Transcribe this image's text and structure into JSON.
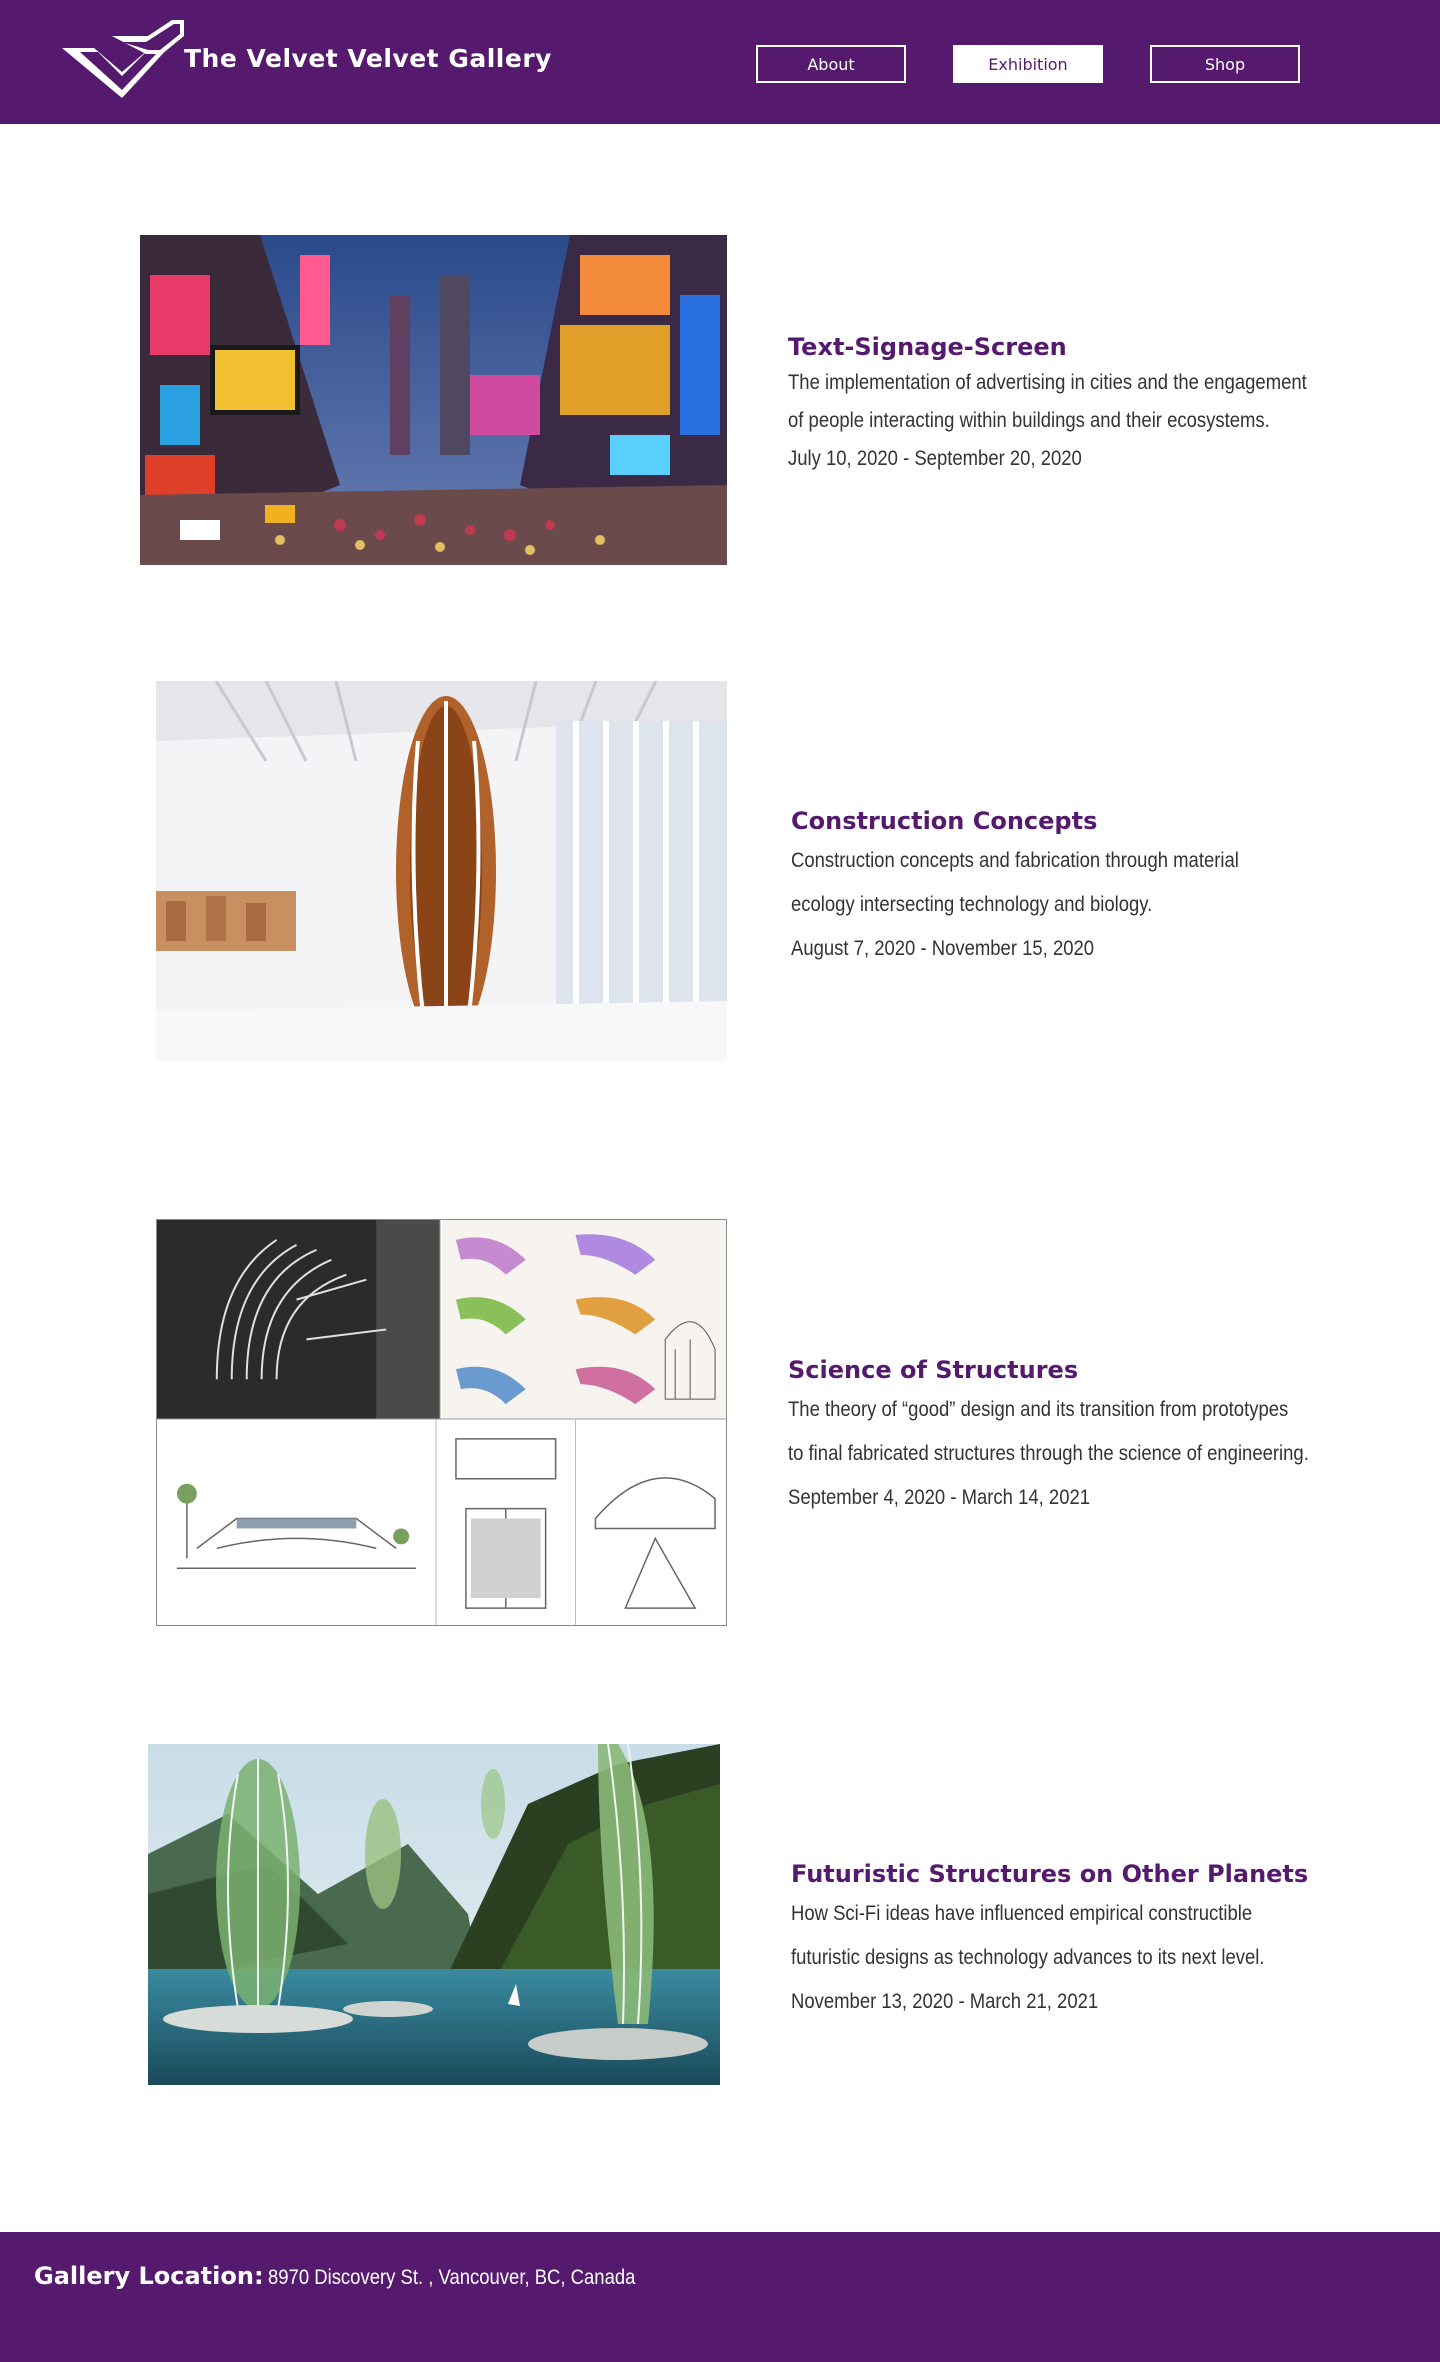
{
  "header": {
    "brand": "The Velvet Velvet Gallery",
    "logo_icon": "velvet-v-logo-icon",
    "nav": [
      {
        "label": "About",
        "active": false
      },
      {
        "label": "Exhibition",
        "active": true
      },
      {
        "label": "Shop",
        "active": false
      }
    ]
  },
  "exhibitions": [
    {
      "title": "Text-Signage-Screen",
      "description_lines": [
        "The implementation of advertising in cities and the engagement",
        "of people interacting within buildings and their ecosystems."
      ],
      "dates": "July 10, 2020 - September 20, 2020",
      "image_icon": "city-signage-photo-icon"
    },
    {
      "title": "Construction Concepts",
      "description_lines": [
        "Construction concepts and fabrication through material",
        "ecology intersecting technology and biology."
      ],
      "dates": "August 7, 2020 - November 15, 2020",
      "image_icon": "sculpture-gallery-photo-icon"
    },
    {
      "title": "Science of Structures",
      "description_lines": [
        "The theory of “good” design and its transition from prototypes",
        "to final fabricated structures through the science of engineering."
      ],
      "dates": "September 4, 2020 - March 14, 2021",
      "image_icon": "architecture-sketches-icon"
    },
    {
      "title": "Futuristic Structures on Other Planets",
      "description_lines": [
        "How Sci-Fi ideas have influenced empirical constructible",
        "futuristic designs as technology advances to its next level."
      ],
      "dates": "November 13, 2020 - March 21, 2021",
      "image_icon": "futuristic-towers-photo-icon"
    }
  ],
  "footer": {
    "label": "Gallery Location:",
    "address": "8970 Discovery St. , Vancouver, BC, Canada"
  },
  "colors": {
    "brand": "#551a6e",
    "white": "#ffffff",
    "text": "#333333"
  }
}
